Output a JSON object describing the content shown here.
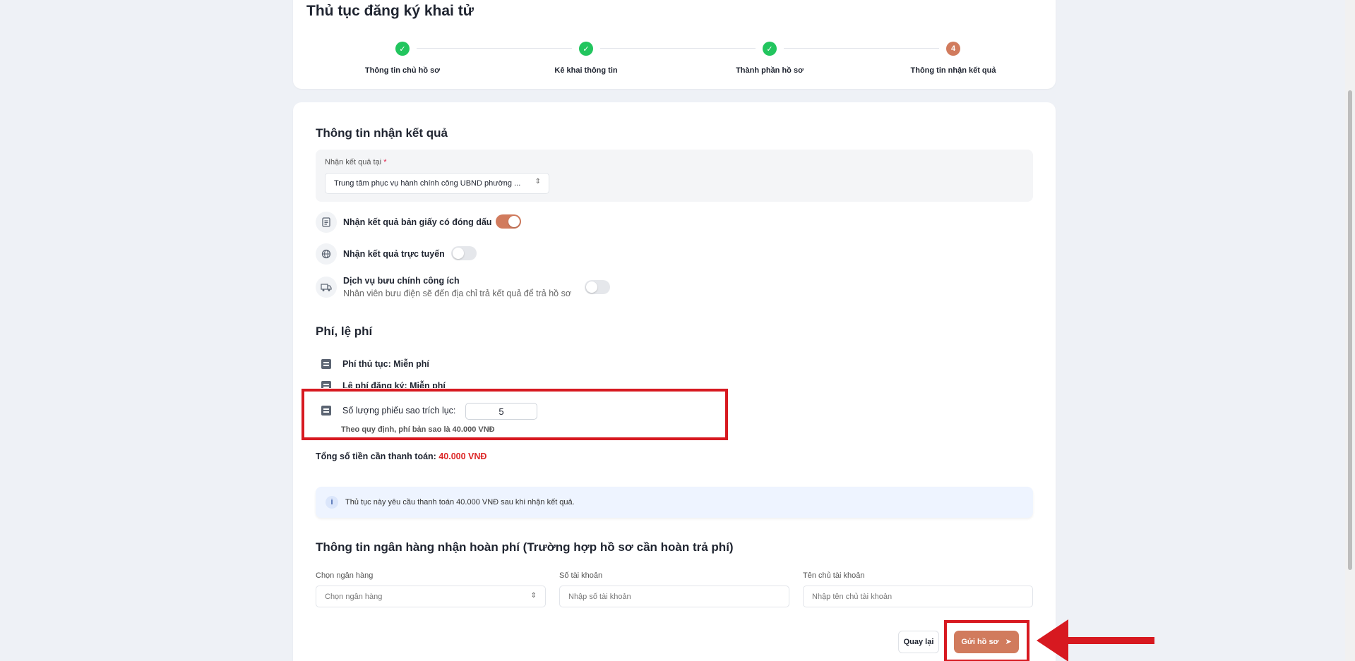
{
  "page": {
    "title": "Thủ tục đăng ký khai tử"
  },
  "stepper": {
    "steps": [
      {
        "label": "Thông tin chủ hồ sơ",
        "status": "done",
        "mark": "✓"
      },
      {
        "label": "Kê khai thông tin",
        "status": "done",
        "mark": "✓"
      },
      {
        "label": "Thành phần hồ sơ",
        "status": "done",
        "mark": "✓"
      },
      {
        "label": "Thông tin nhận kết quả",
        "status": "current",
        "mark": "4"
      }
    ]
  },
  "result": {
    "section_title": "Thông tin nhận kết quả",
    "location_label": "Nhận kết quả tại",
    "required_mark": "*",
    "location_value": "Trung tâm phục vụ hành chính công UBND phường ...",
    "options": [
      {
        "title": "Nhận kết quả bản giấy có đóng dấu",
        "subtitle": "",
        "enabled": true,
        "icon": "document-icon"
      },
      {
        "title": "Nhận kết quả trực tuyến",
        "subtitle": "",
        "enabled": false,
        "icon": "globe-icon"
      },
      {
        "title": "Dịch vụ bưu chính công ích",
        "subtitle": "Nhân viên bưu điện sẽ đến địa chỉ trả kết quả để trả hồ sơ",
        "enabled": false,
        "icon": "truck-icon"
      }
    ]
  },
  "fees": {
    "section_title": "Phí, lệ phí",
    "procedure_fee": "Phí thủ tục: Miễn phí",
    "registration_fee": "Lệ phí đăng ký: Miễn phí",
    "copies_label": "Số lượng phiếu sao trích lục:",
    "copies_value": "5",
    "copies_note": "Theo quy định, phí bản sao là 40.000 VNĐ",
    "total_label": "Tổng số tiền cần thanh toán:",
    "total_amount": "40.000 VNĐ",
    "info_text": "Thủ tục này yêu cầu thanh toán 40.000 VNĐ sau khi nhận kết quả."
  },
  "bank": {
    "section_title": "Thông tin ngân hàng nhận hoàn phí (Trường hợp hồ sơ cần hoàn trả phí)",
    "bank_label": "Chọn ngân hàng",
    "bank_placeholder": "Chọn ngân hàng",
    "account_label": "Số tài khoản",
    "account_placeholder": "Nhập số tài khoản",
    "holder_label": "Tên chủ tài khoản",
    "holder_placeholder": "Nhập tên chủ tài khoản"
  },
  "actions": {
    "back_label": "Quay lại",
    "submit_label": "Gửi hồ sơ"
  },
  "colors": {
    "accent": "#d17b5d",
    "success": "#22c55e",
    "highlight": "#d71920",
    "total": "#dc2626"
  }
}
